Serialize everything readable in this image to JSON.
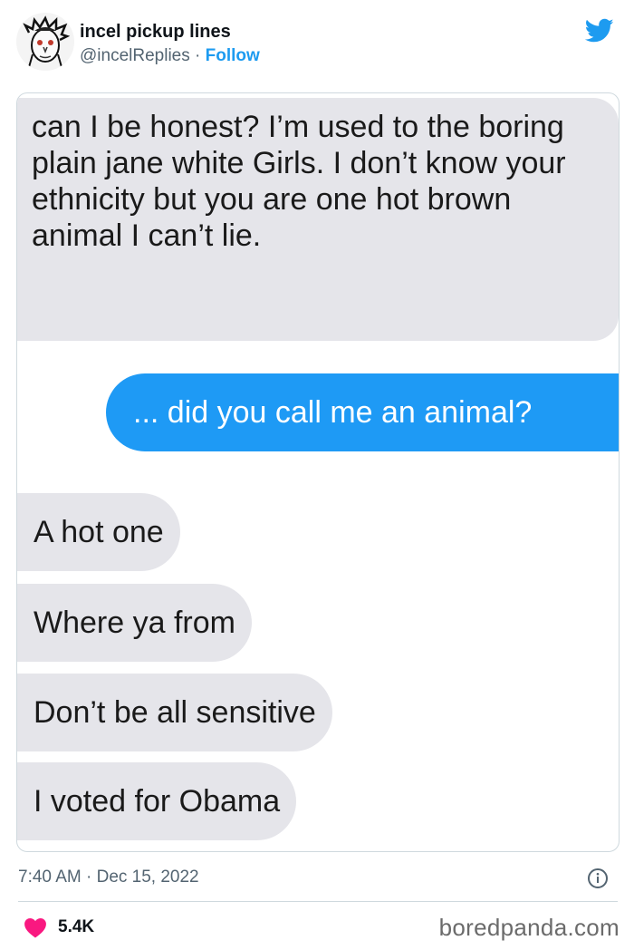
{
  "tweet": {
    "display_name": "incel pickup lines",
    "handle": "@incelReplies",
    "separator": "·",
    "follow_label": "Follow",
    "timestamp": "7:40 AM · Dec 15, 2022",
    "likes": "5.4K",
    "brand_color": "#1d9bf0",
    "like_color": "#f91880",
    "icons": [
      "twitter-bird-icon",
      "info-icon",
      "heart-icon"
    ]
  },
  "conversation": {
    "messages": [
      {
        "side": "received",
        "text": "can I  be honest? I’m used to the boring plain jane white Girls. I don’t know your ethnicity but you are one hot brown animal I can’t lie."
      },
      {
        "side": "sent",
        "text": "... did you call me an animal?"
      },
      {
        "side": "received",
        "text": "A hot one"
      },
      {
        "side": "received",
        "text": "Where  ya from"
      },
      {
        "side": "received",
        "text": "Don’t be all sensitive"
      },
      {
        "side": "received",
        "text": "I voted for Obama"
      }
    ],
    "received_color": "#e5e5ea",
    "sent_color": "#1e9af5"
  },
  "watermark": "boredpanda.com"
}
